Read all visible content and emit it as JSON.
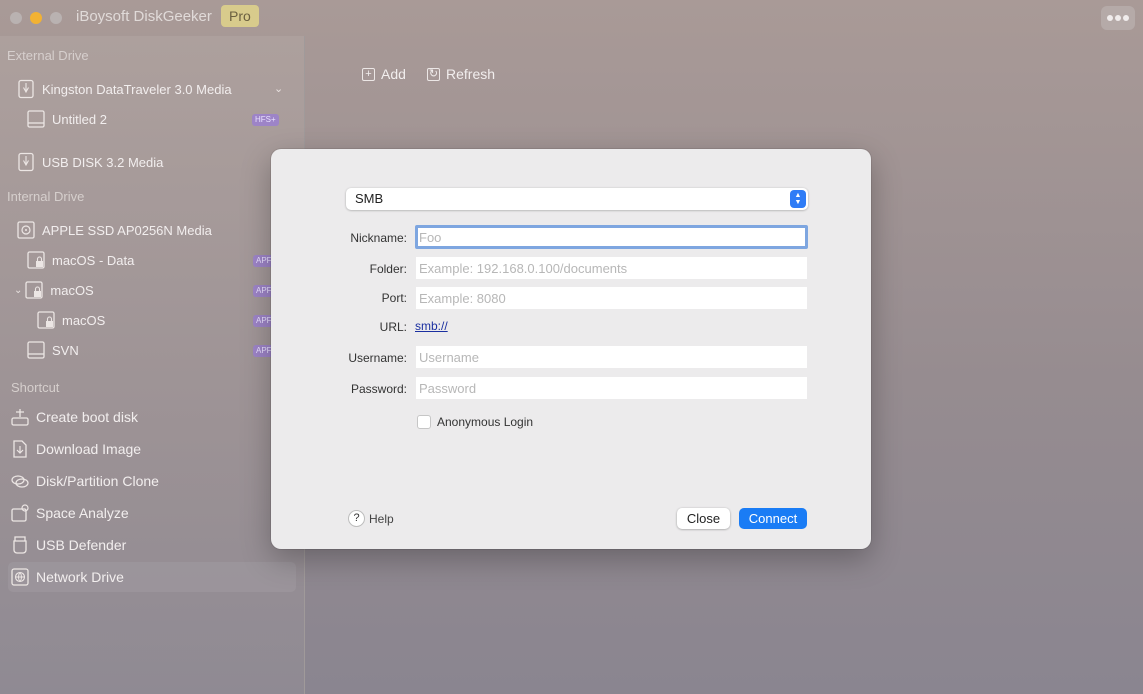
{
  "window": {
    "title": "iBoysoft DiskGeeker",
    "badge": "Pro"
  },
  "sidebar": {
    "external_title": "External Drive",
    "internal_title": "Internal Drive",
    "shortcut_title": "Shortcut",
    "external": [
      {
        "label": "Kingston DataTraveler 3.0 Media",
        "icon": "usb-drive-icon"
      },
      {
        "label": "Untitled 2",
        "icon": "volume-icon",
        "badge": "HFS+"
      },
      {
        "label": "USB DISK 3.2 Media",
        "icon": "usb-drive-icon"
      }
    ],
    "internal": [
      {
        "label": "APPLE SSD AP0256N Media",
        "icon": "internal-disk-icon"
      },
      {
        "label": "macOS - Data",
        "icon": "locked-volume-icon",
        "badge": "APF"
      },
      {
        "label": "macOS",
        "icon": "locked-volume-icon",
        "badge": "APF"
      },
      {
        "label": "macOS",
        "icon": "locked-volume-icon",
        "badge": "APF"
      },
      {
        "label": "SVN",
        "icon": "volume-icon",
        "badge": "APF"
      }
    ],
    "shortcuts": [
      {
        "label": "Create boot disk",
        "icon": "boot-disk-icon"
      },
      {
        "label": "Download Image",
        "icon": "download-icon"
      },
      {
        "label": "Disk/Partition Clone",
        "icon": "clone-icon"
      },
      {
        "label": "Space Analyze",
        "icon": "space-analyze-icon"
      },
      {
        "label": "USB Defender",
        "icon": "usb-defender-icon"
      },
      {
        "label": "Network Drive",
        "icon": "network-drive-icon",
        "active": true
      }
    ]
  },
  "toolbar": {
    "add_label": "Add",
    "refresh_label": "Refresh"
  },
  "dialog": {
    "protocol": "SMB",
    "nickname_label": "Nickname:",
    "nickname_placeholder": "Foo",
    "folder_label": "Folder:",
    "folder_placeholder": "Example: 192.168.0.100/documents",
    "port_label": "Port:",
    "port_placeholder": "Example: 8080",
    "url_label": "URL:",
    "url_value": "smb://",
    "username_label": "Username:",
    "username_placeholder": "Username",
    "password_label": "Password:",
    "password_placeholder": "Password",
    "anonymous_label": "Anonymous Login",
    "help_label": "Help",
    "close_label": "Close",
    "connect_label": "Connect"
  },
  "colors": {
    "accent": "#1a7cf5",
    "badge": "#9d84c7",
    "pro_badge": "#d8cb8c"
  }
}
